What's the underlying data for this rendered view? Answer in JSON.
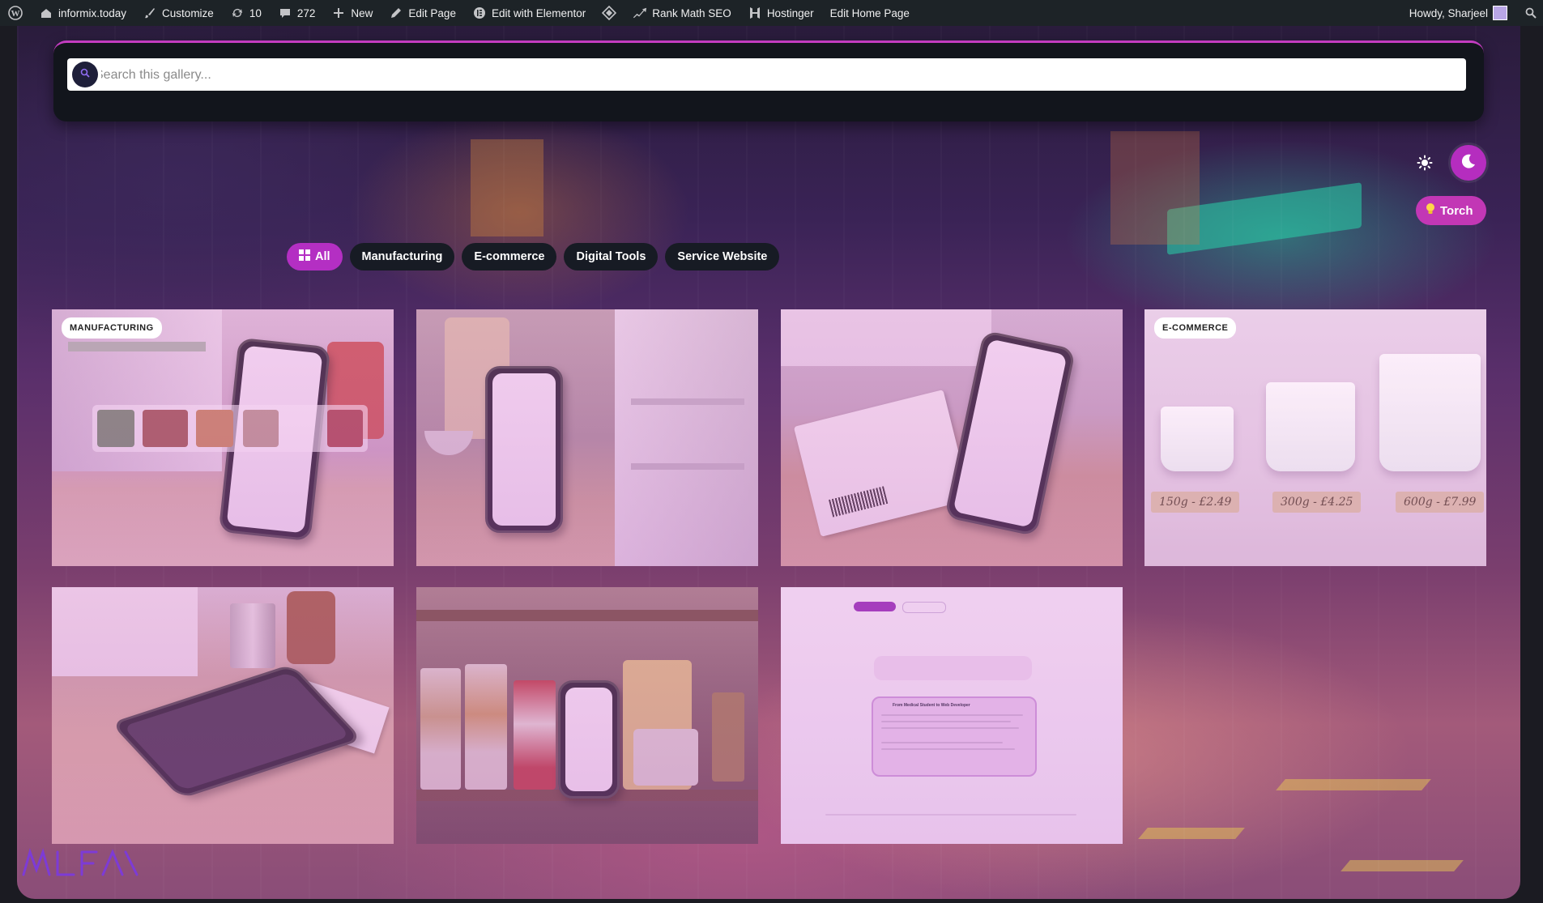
{
  "admin_bar": {
    "site_name": "informix.today",
    "customize": "Customize",
    "updates": "10",
    "comments": "272",
    "new": "New",
    "edit_page": "Edit Page",
    "edit_elementor": "Edit with Elementor",
    "rank_math": "Rank Math SEO",
    "hostinger": "Hostinger",
    "edit_home": "Edit Home Page",
    "greeting": "Howdy, Sharjeel"
  },
  "search": {
    "placeholder": "Search this gallery...",
    "icon": "search-icon"
  },
  "theme": {
    "light_icon": "sun-icon",
    "dark_icon": "moon-icon",
    "torch_label": "Torch",
    "accent": "#b42fc3"
  },
  "filters": [
    {
      "label": "All",
      "active": true
    },
    {
      "label": "Manufacturing",
      "active": false
    },
    {
      "label": "E-commerce",
      "active": false
    },
    {
      "label": "Digital Tools",
      "active": false
    },
    {
      "label": "Service Website",
      "active": false
    }
  ],
  "gallery": {
    "tiles": [
      {
        "badge": "MANUFACTURING"
      },
      {
        "badge": ""
      },
      {
        "badge": ""
      },
      {
        "badge": "E-COMMERCE",
        "price_tags": [
          "150g - £2.49",
          "300g - £4.25",
          "600g - £7.99"
        ]
      },
      {
        "badge": ""
      },
      {
        "badge": ""
      },
      {
        "badge": "",
        "screenshot_title": "From Medical Student to Web Developer"
      }
    ]
  }
}
